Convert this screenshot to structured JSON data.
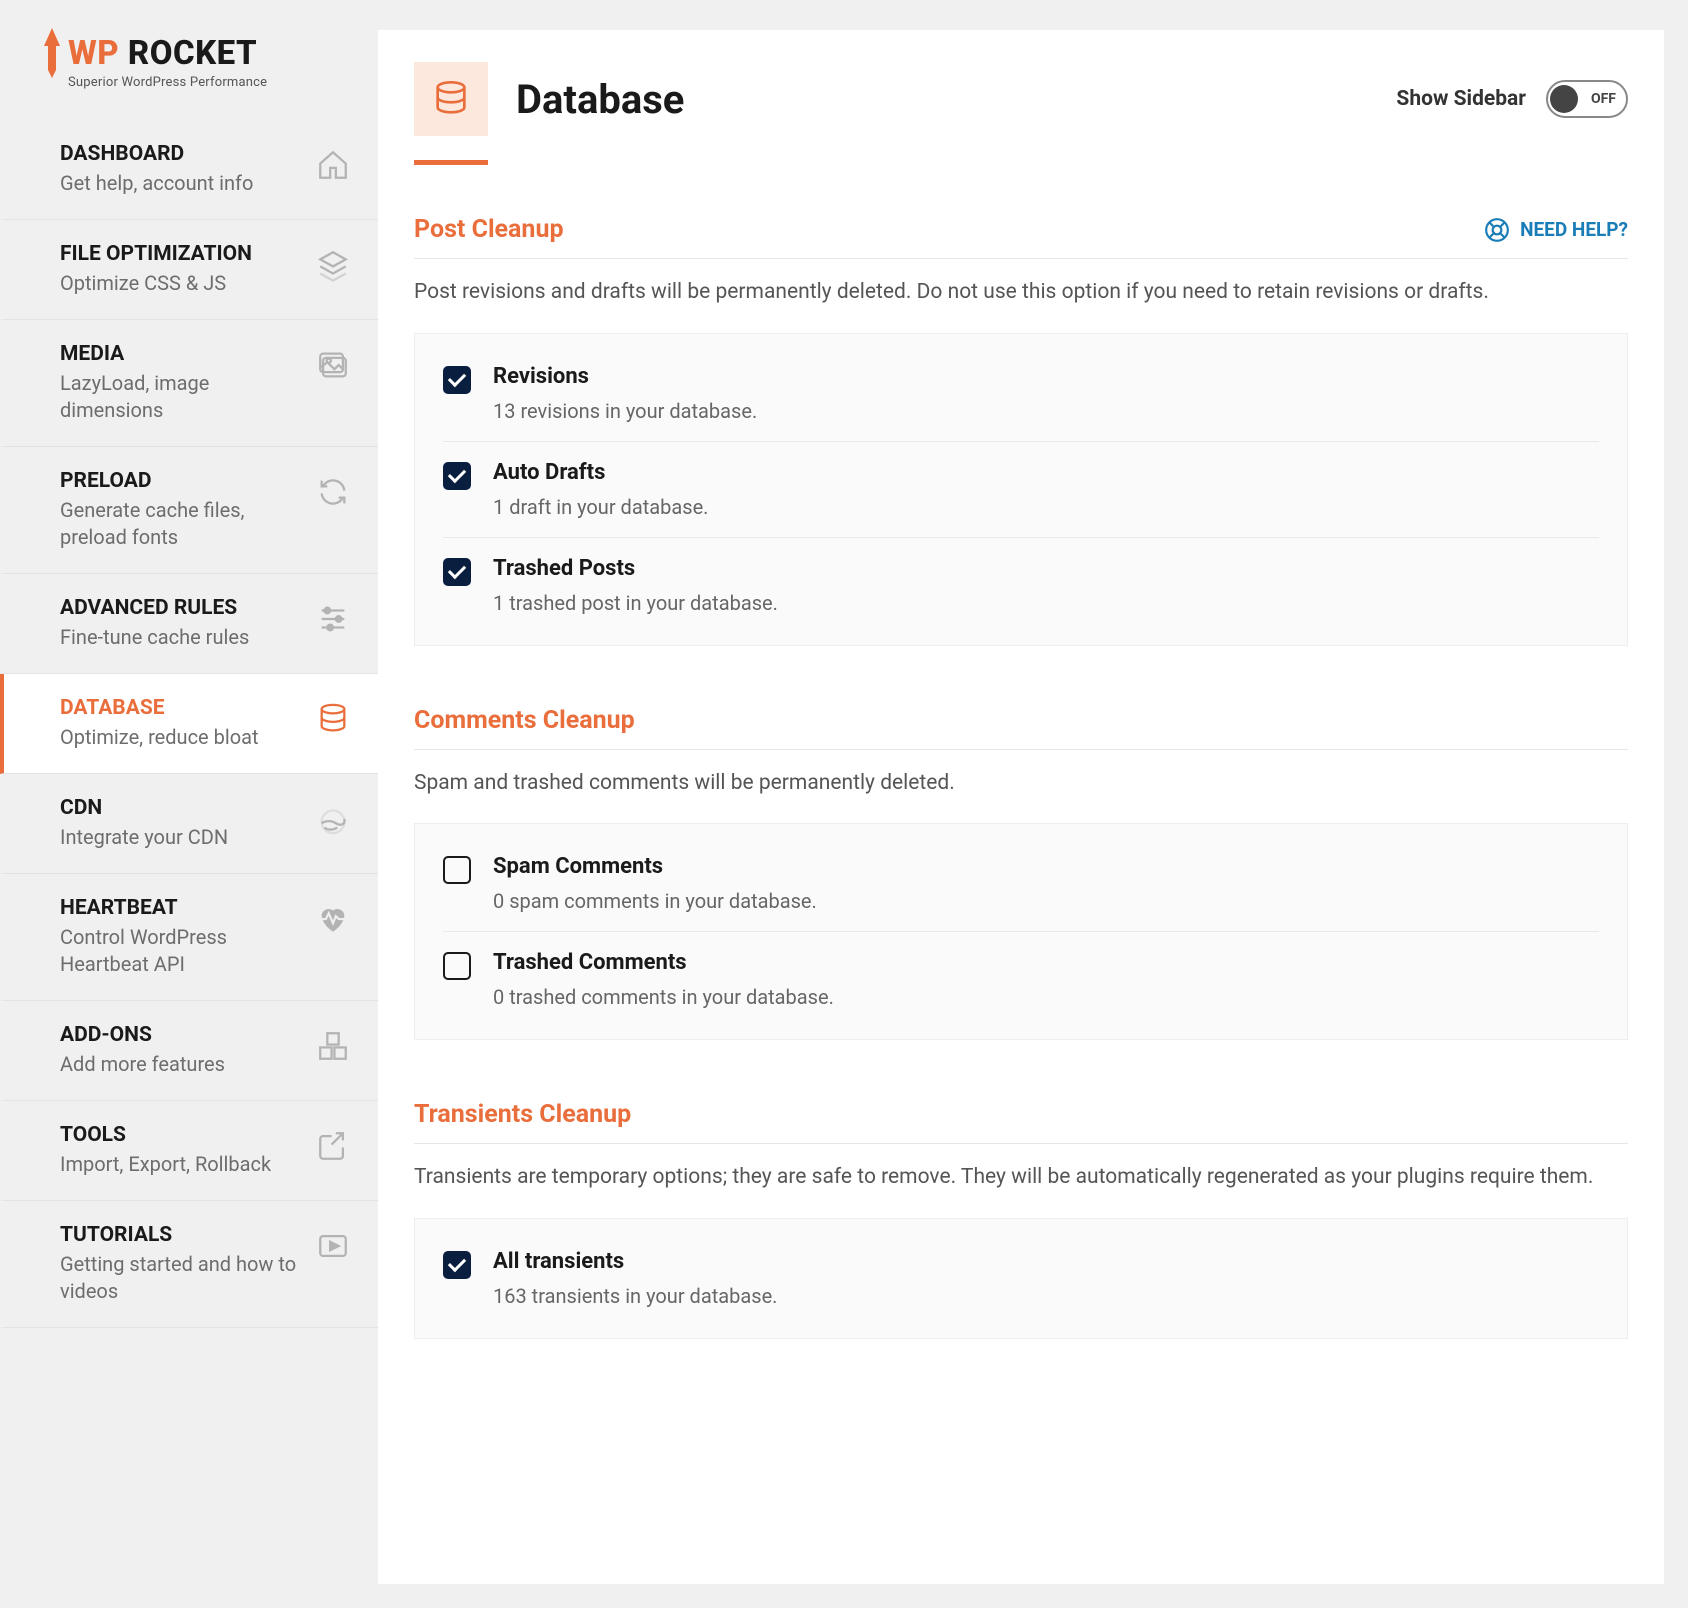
{
  "brand": {
    "name_part1": "WP",
    "name_part2": " ROCKET",
    "tagline": "Superior WordPress Performance"
  },
  "sidebar": {
    "items": [
      {
        "title": "DASHBOARD",
        "subtitle": "Get help, account info",
        "icon": "home"
      },
      {
        "title": "FILE OPTIMIZATION",
        "subtitle": "Optimize CSS & JS",
        "icon": "layers"
      },
      {
        "title": "MEDIA",
        "subtitle": "LazyLoad, image dimensions",
        "icon": "images"
      },
      {
        "title": "PRELOAD",
        "subtitle": "Generate cache files, preload fonts",
        "icon": "refresh"
      },
      {
        "title": "ADVANCED RULES",
        "subtitle": "Fine-tune cache rules",
        "icon": "sliders"
      },
      {
        "title": "DATABASE",
        "subtitle": "Optimize, reduce bloat",
        "icon": "database",
        "active": true
      },
      {
        "title": "CDN",
        "subtitle": "Integrate your CDN",
        "icon": "globe"
      },
      {
        "title": "HEARTBEAT",
        "subtitle": "Control WordPress Heartbeat API",
        "icon": "heartbeat"
      },
      {
        "title": "ADD-ONS",
        "subtitle": "Add more features",
        "icon": "boxes"
      },
      {
        "title": "TOOLS",
        "subtitle": "Import, Export, Rollback",
        "icon": "export"
      },
      {
        "title": "TUTORIALS",
        "subtitle": "Getting started and how to videos",
        "icon": "video"
      }
    ]
  },
  "header": {
    "title": "Database",
    "show_sidebar_label": "Show Sidebar",
    "toggle_text": "OFF"
  },
  "need_help_label": "NEED HELP?",
  "sections": {
    "post_cleanup": {
      "title": "Post Cleanup",
      "desc": "Post revisions and drafts will be permanently deleted. Do not use this option if you need to retain revisions or drafts.",
      "options": [
        {
          "label": "Revisions",
          "sub": "13 revisions in your database.",
          "checked": true
        },
        {
          "label": "Auto Drafts",
          "sub": "1 draft in your database.",
          "checked": true
        },
        {
          "label": "Trashed Posts",
          "sub": "1 trashed post in your database.",
          "checked": true
        }
      ]
    },
    "comments_cleanup": {
      "title": "Comments Cleanup",
      "desc": "Spam and trashed comments will be permanently deleted.",
      "options": [
        {
          "label": "Spam Comments",
          "sub": "0 spam comments in your database.",
          "checked": false
        },
        {
          "label": "Trashed Comments",
          "sub": "0 trashed comments in your database.",
          "checked": false
        }
      ]
    },
    "transients_cleanup": {
      "title": "Transients Cleanup",
      "desc": "Transients are temporary options; they are safe to remove. They will be automatically regenerated as your plugins require them.",
      "options": [
        {
          "label": "All transients",
          "sub": "163 transients in your database.",
          "checked": true
        }
      ]
    }
  }
}
